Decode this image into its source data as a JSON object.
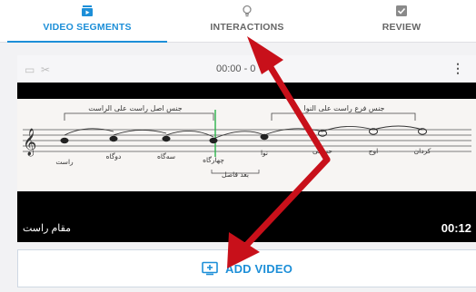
{
  "tabs": [
    {
      "label": "VIDEO SEGMENTS",
      "icon": "segments-icon",
      "active": true
    },
    {
      "label": "INTERACTIONS",
      "icon": "lightbulb-icon",
      "active": false
    },
    {
      "label": "REVIEW",
      "icon": "checkbox-icon",
      "active": false
    }
  ],
  "segment": {
    "time_range": "00:00 - 0",
    "caption": "مقام راست",
    "duration": "00:12",
    "sheet_labels": {
      "bracket_left": "جنس اصل راست علی الراست",
      "bracket_right": "جنس فرع راست علی النوا",
      "note_rast": "راست",
      "note_dugah": "دوگاه",
      "note_segah": "سه‌گاه",
      "note_chahargah": "چهارگاه",
      "note_nava": "نوا",
      "note_hosseini": "حسینی",
      "note_owj": "اوج",
      "note_kardan": "کردان",
      "sep_label": "بعد فاصل"
    }
  },
  "add_video": {
    "label": "ADD VIDEO"
  },
  "colors": {
    "accent": "#1d8fd8",
    "arrow": "#c8101a"
  }
}
